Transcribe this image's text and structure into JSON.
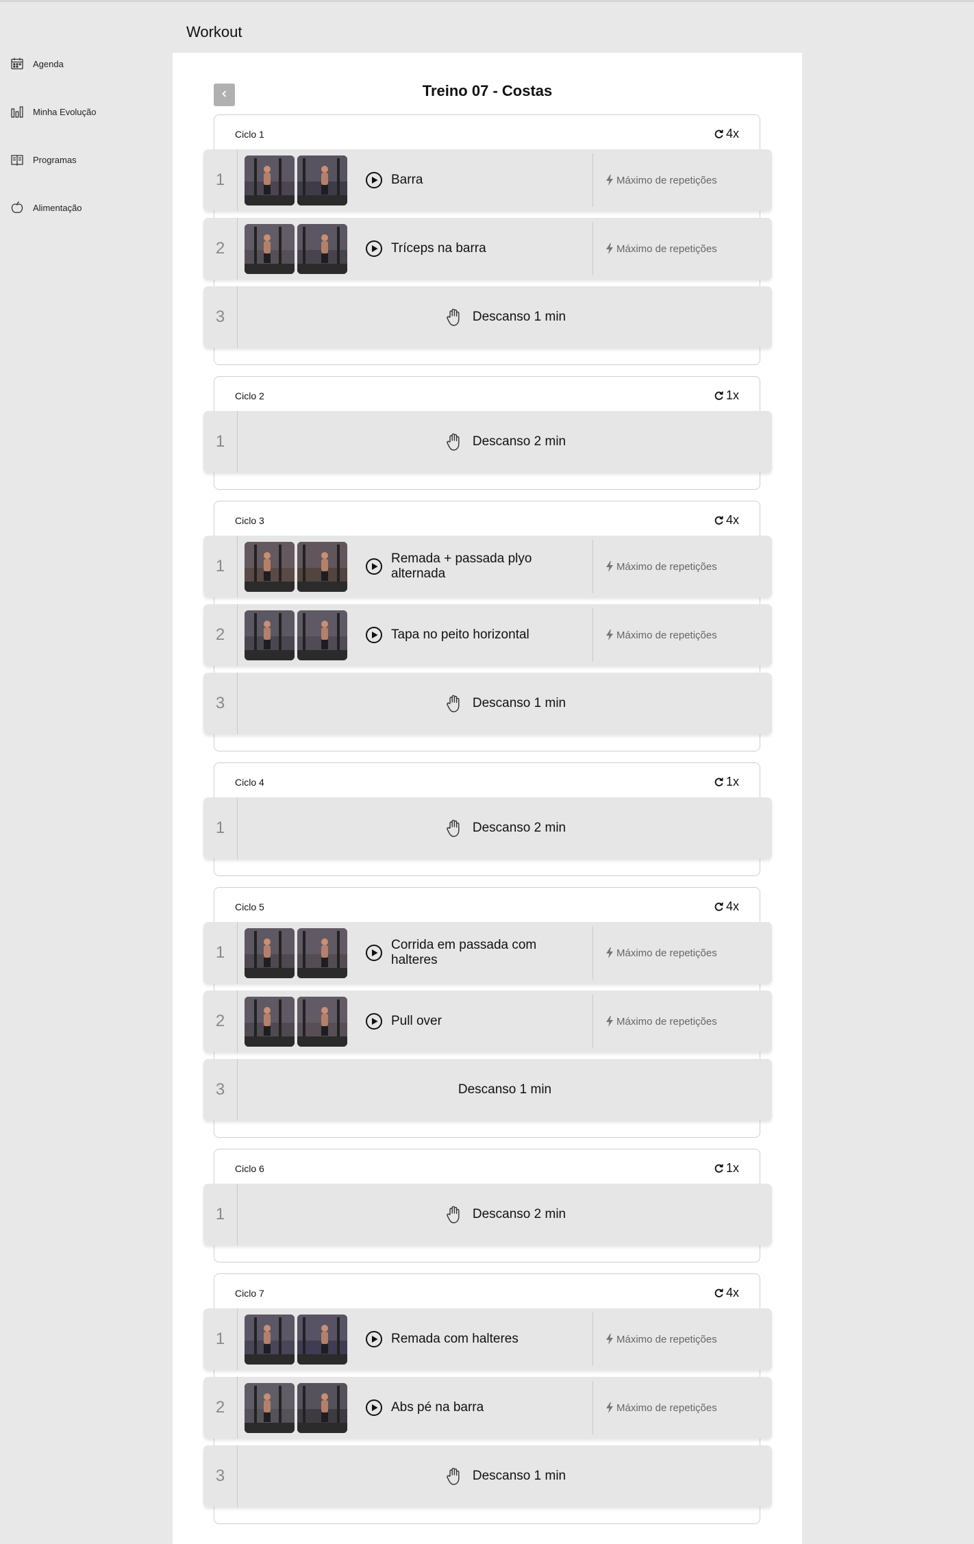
{
  "app": {
    "title": "Workout"
  },
  "sidebar": {
    "items": [
      {
        "label": "Agenda",
        "icon": "calendar-icon"
      },
      {
        "label": "Minha Evolução",
        "icon": "bar-chart-icon"
      },
      {
        "label": "Programas",
        "icon": "book-icon"
      },
      {
        "label": "Alimentação",
        "icon": "apple-icon"
      }
    ]
  },
  "workout": {
    "title": "Treino 07 - Costas",
    "mode_label": "Máximo de repetições",
    "cycles": [
      {
        "label": "Ciclo 1",
        "reps": "4x",
        "rows": [
          {
            "index": "1",
            "type": "exercise",
            "name": "Barra",
            "thumbs": [
              "#4a4550",
              "#3e3c48"
            ]
          },
          {
            "index": "2",
            "type": "exercise",
            "name": "Tríceps na barra",
            "thumbs": [
              "#555058",
              "#48444e"
            ]
          },
          {
            "index": "3",
            "type": "rest",
            "name": "Descanso 1 min",
            "hand": true
          }
        ]
      },
      {
        "label": "Ciclo 2",
        "reps": "1x",
        "rows": [
          {
            "index": "1",
            "type": "rest",
            "name": "Descanso 2 min",
            "hand": true
          }
        ]
      },
      {
        "label": "Ciclo 3",
        "reps": "4x",
        "rows": [
          {
            "index": "1",
            "type": "exercise",
            "name": "Remada + passada plyo alternada",
            "thumbs": [
              "#5a4a46",
              "#52443f"
            ]
          },
          {
            "index": "2",
            "type": "exercise",
            "name": "Tapa no peito horizontal",
            "thumbs": [
              "#4b4750",
              "#514b55"
            ]
          },
          {
            "index": "3",
            "type": "rest",
            "name": "Descanso 1 min",
            "hand": true
          }
        ]
      },
      {
        "label": "Ciclo 4",
        "reps": "1x",
        "rows": [
          {
            "index": "1",
            "type": "rest",
            "name": "Descanso 2 min",
            "hand": true
          }
        ]
      },
      {
        "label": "Ciclo 5",
        "reps": "4x",
        "rows": [
          {
            "index": "1",
            "type": "exercise",
            "name": "Corrida em passada com halteres",
            "thumbs": [
              "#4e4850",
              "#544c52"
            ]
          },
          {
            "index": "2",
            "type": "exercise",
            "name": "Pull over",
            "thumbs": [
              "#4f4a52",
              "#574f55"
            ]
          },
          {
            "index": "3",
            "type": "rest",
            "name": "Descanso 1 min",
            "hand": false
          }
        ]
      },
      {
        "label": "Ciclo 6",
        "reps": "1x",
        "rows": [
          {
            "index": "1",
            "type": "rest",
            "name": "Descanso 2 min",
            "hand": true
          }
        ]
      },
      {
        "label": "Ciclo 7",
        "reps": "4x",
        "rows": [
          {
            "index": "1",
            "type": "exercise",
            "name": "Remada com halteres",
            "thumbs": [
              "#4a4658",
              "#3f3c54"
            ]
          },
          {
            "index": "2",
            "type": "exercise",
            "name": "Abs pé na barra",
            "thumbs": [
              "#55525a",
              "#3d3a42"
            ]
          },
          {
            "index": "3",
            "type": "rest",
            "name": "Descanso 1 min",
            "hand": true
          }
        ]
      }
    ]
  }
}
